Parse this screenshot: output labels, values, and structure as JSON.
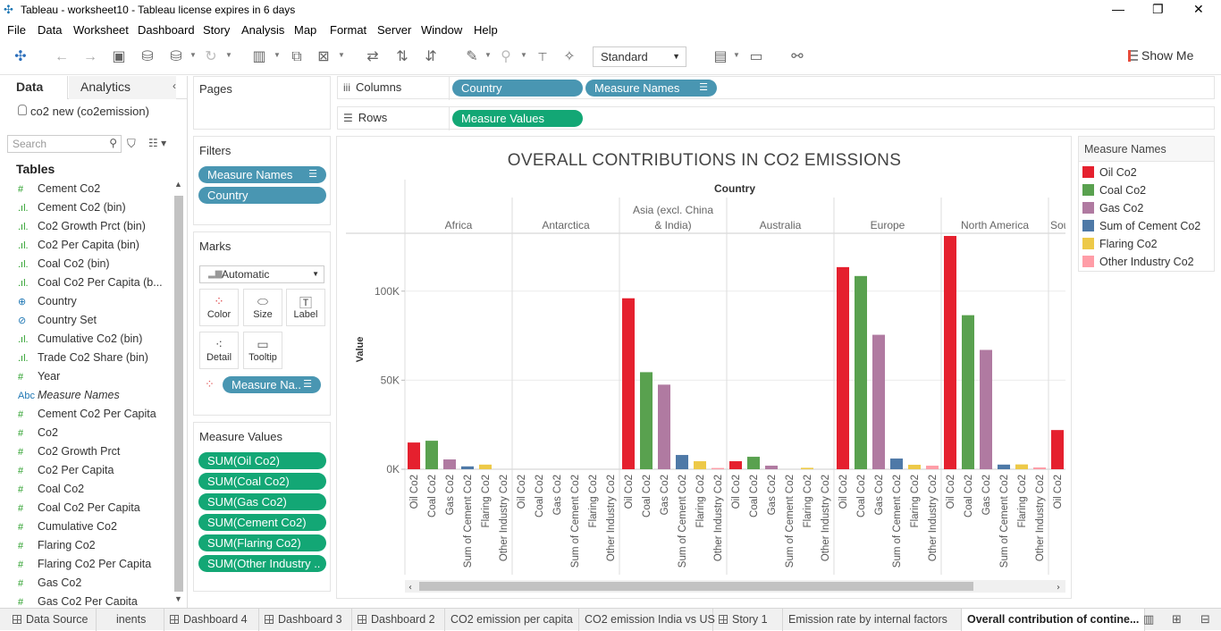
{
  "window": {
    "title": "Tableau - worksheet10 - Tableau license expires in 6 days"
  },
  "menu": [
    "File",
    "Data",
    "Worksheet",
    "Dashboard",
    "Story",
    "Analysis",
    "Map",
    "Format",
    "Server",
    "Window",
    "Help"
  ],
  "toolbar": {
    "fit": "Standard",
    "show_me": "Show Me"
  },
  "datapane": {
    "tab_data": "Data",
    "tab_analytics": "Analytics",
    "source": "co2 new (co2emission)",
    "search_placeholder": "Search",
    "tables_header": "Tables",
    "fields": [
      {
        "icon": "#",
        "name": "Cement Co2"
      },
      {
        "icon": ".ıl.",
        "name": "Cement Co2 (bin)"
      },
      {
        "icon": ".ıl.",
        "name": "Co2 Growth Prct (bin)"
      },
      {
        "icon": ".ıl.",
        "name": "Co2 Per Capita (bin)"
      },
      {
        "icon": ".ıl.",
        "name": "Coal Co2 (bin)"
      },
      {
        "icon": ".ıl.",
        "name": "Coal Co2 Per Capita (b..."
      },
      {
        "icon": "⊕",
        "name": "Country"
      },
      {
        "icon": "⊘",
        "name": "Country Set"
      },
      {
        "icon": ".ıl.",
        "name": "Cumulative Co2 (bin)"
      },
      {
        "icon": ".ıl.",
        "name": "Trade Co2 Share (bin)"
      },
      {
        "icon": "#",
        "name": "Year"
      },
      {
        "icon": "Abc",
        "name": "Measure Names"
      },
      {
        "icon": "#",
        "name": "Cement Co2 Per Capita"
      },
      {
        "icon": "#",
        "name": "Co2"
      },
      {
        "icon": "#",
        "name": "Co2 Growth Prct"
      },
      {
        "icon": "#",
        "name": "Co2 Per Capita"
      },
      {
        "icon": "#",
        "name": "Coal Co2"
      },
      {
        "icon": "#",
        "name": "Coal Co2 Per Capita"
      },
      {
        "icon": "#",
        "name": "Cumulative Co2"
      },
      {
        "icon": "#",
        "name": "Flaring Co2"
      },
      {
        "icon": "#",
        "name": "Flaring Co2 Per Capita"
      },
      {
        "icon": "#",
        "name": "Gas Co2"
      },
      {
        "icon": "#",
        "name": "Gas Co2 Per Capita"
      }
    ]
  },
  "pages": {
    "header": "Pages"
  },
  "filters": {
    "header": "Filters",
    "items": [
      "Measure Names",
      "Country"
    ]
  },
  "marks": {
    "header": "Marks",
    "type": "Automatic",
    "buttons": {
      "color": "Color",
      "size": "Size",
      "label": "Label",
      "detail": "Detail",
      "tooltip": "Tooltip"
    },
    "pill": "Measure Na.."
  },
  "measure_values": {
    "header": "Measure Values",
    "items": [
      "SUM(Oil Co2)",
      "SUM(Coal Co2)",
      "SUM(Gas Co2)",
      "SUM(Cement Co2)",
      "SUM(Flaring Co2)",
      "SUM(Other Industry .."
    ]
  },
  "shelves": {
    "columns_label": "Columns",
    "rows_label": "Rows",
    "columns": [
      "Country",
      "Measure Names"
    ],
    "rows": [
      "Measure Values"
    ]
  },
  "legend": {
    "header": "Measure Names"
  },
  "colors": {
    "Oil Co2": "#e5202e",
    "Coal Co2": "#59a14f",
    "Gas Co2": "#b07aa1",
    "Sum of Cement Co2": "#4e79a7",
    "Flaring Co2": "#edc948",
    "Other Industry Co2": "#ff9da7"
  },
  "chart_data": {
    "type": "bar",
    "title": "OVERALL CONTRIBUTIONS IN CO2 EMISSIONS",
    "column_header": "Country",
    "ylabel": "Value",
    "yticks": [
      {
        "v": 0,
        "label": "0K"
      },
      {
        "v": 50000,
        "label": "50K"
      },
      {
        "v": 100000,
        "label": "100K"
      }
    ],
    "ylim": [
      0,
      132000
    ],
    "measures": [
      "Oil Co2",
      "Coal Co2",
      "Gas Co2",
      "Sum of Cement Co2",
      "Flaring Co2",
      "Other Industry Co2"
    ],
    "groups": [
      {
        "name": "Africa",
        "values": [
          15000,
          16000,
          5500,
          1600,
          2600,
          0
        ]
      },
      {
        "name": "Antarctica",
        "values": [
          0,
          0,
          0,
          0,
          0,
          0
        ]
      },
      {
        "name": "Asia (excl. China & India)",
        "values": [
          96000,
          54500,
          47500,
          8000,
          4500,
          700
        ]
      },
      {
        "name": "Australia",
        "values": [
          4500,
          7000,
          2000,
          0,
          800,
          0
        ]
      },
      {
        "name": "Europe",
        "values": [
          113500,
          108500,
          75500,
          6000,
          2500,
          2000
        ]
      },
      {
        "name": "North America",
        "values": [
          131000,
          86500,
          67000,
          2600,
          2700,
          1000
        ]
      },
      {
        "name": "South America",
        "values": [
          22000,
          0,
          0,
          0,
          0,
          0
        ]
      }
    ]
  },
  "status_tabs": [
    {
      "label": "Data Source",
      "icon": "db"
    },
    {
      "label": "inents",
      "icon": ""
    },
    {
      "label": "Dashboard 4",
      "icon": "grid"
    },
    {
      "label": "Dashboard 3",
      "icon": "grid"
    },
    {
      "label": "Dashboard 2",
      "icon": "grid"
    },
    {
      "label": "CO2 emission per capita",
      "icon": ""
    },
    {
      "label": "CO2 emission India vs US",
      "icon": ""
    },
    {
      "label": "Story 1",
      "icon": "grid"
    },
    {
      "label": "Emission rate by internal factors",
      "icon": ""
    },
    {
      "label": "Overall contribution of contine...",
      "icon": "",
      "active": true
    }
  ]
}
